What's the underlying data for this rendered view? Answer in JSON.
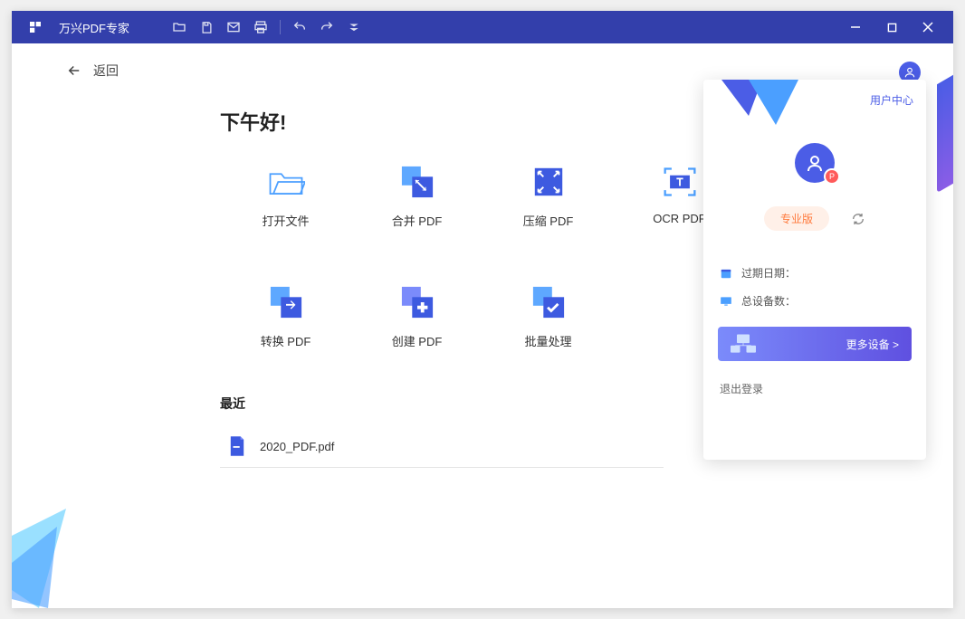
{
  "app": {
    "title": "万兴PDF专家"
  },
  "back": {
    "label": "返回"
  },
  "greeting": "下午好!",
  "actions": [
    {
      "label": "打开文件"
    },
    {
      "label": "合并 PDF"
    },
    {
      "label": "压缩 PDF"
    },
    {
      "label": "OCR PDF"
    },
    {
      "label": "转换 PDF"
    },
    {
      "label": "创建 PDF"
    },
    {
      "label": "批量处理"
    }
  ],
  "recent": {
    "title": "最近",
    "items": [
      {
        "name": "2020_PDF.pdf"
      }
    ]
  },
  "panel": {
    "user_center": "用户中心",
    "badge": "P",
    "plan": "专业版",
    "expiry_label": "过期日期：",
    "devices_label": "总设备数：",
    "more_devices": "更多设备 >",
    "logout": "退出登录"
  }
}
